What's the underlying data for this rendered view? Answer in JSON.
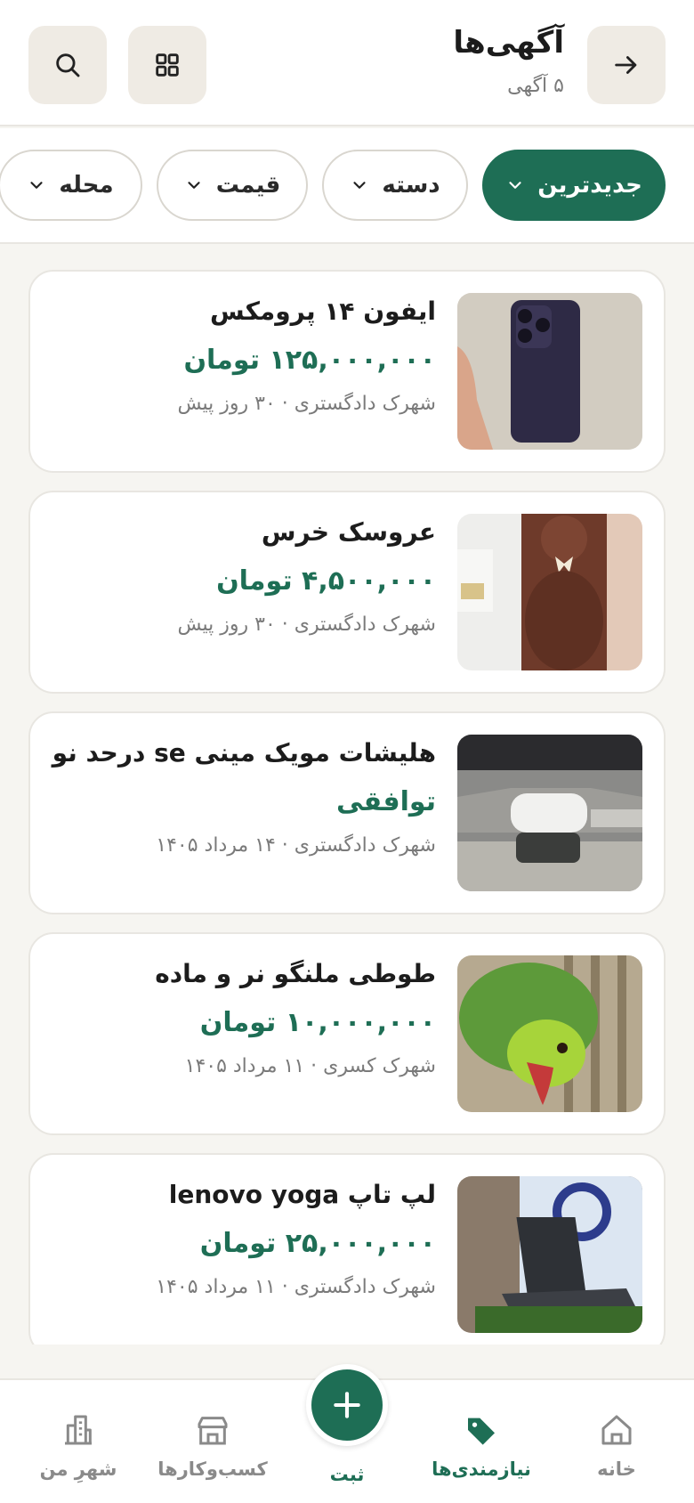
{
  "header": {
    "title": "آگهی‌ها",
    "subtitle": "۵ آگهی",
    "icons": {
      "back": "arrow-right-icon",
      "grid": "grid-icon",
      "search": "search-icon"
    }
  },
  "filters": {
    "newest": "جدیدترین",
    "category": "دسته",
    "price": "قیمت",
    "area": "محله"
  },
  "ads": [
    {
      "title": "ایفون ۱۴ پرومکس",
      "price": "۱۲۵,۰۰۰,۰۰۰ تومان",
      "meta": "شهرک دادگستری · ۳۰ روز پیش",
      "image": "phone-photo"
    },
    {
      "title": "عروسک خرس",
      "price": "۴,۵۰۰,۰۰۰ تومان",
      "meta": "شهرک دادگستری · ۳۰ روز پیش",
      "image": "teddy-bear-photo"
    },
    {
      "title": "هلیشات مویک مینی se درحد نو",
      "price": "توافقی",
      "meta": "شهرک دادگستری · ۱۴ مرداد ۱۴۰۵",
      "image": "drone-photo"
    },
    {
      "title": "طوطی ملنگو نر و ماده",
      "price": "۱۰,۰۰۰,۰۰۰ تومان",
      "meta": "شهرک کسری · ۱۱ مرداد ۱۴۰۵",
      "image": "parrot-photo"
    },
    {
      "title": "لپ تاپ lenovo yoga",
      "price": "۲۵,۰۰۰,۰۰۰ تومان",
      "meta": "شهرک دادگستری · ۱۱ مرداد ۱۴۰۵",
      "image": "laptop-photo"
    }
  ],
  "nav": {
    "home": "خانه",
    "needs": "نیازمندی‌ها",
    "post": "ثبت",
    "business": "کسب‌وکارها",
    "city": "شهرِ من"
  },
  "colors": {
    "accent": "#1e6e55",
    "background": "#f6f5f1",
    "chip_border": "#d9d6cf"
  }
}
